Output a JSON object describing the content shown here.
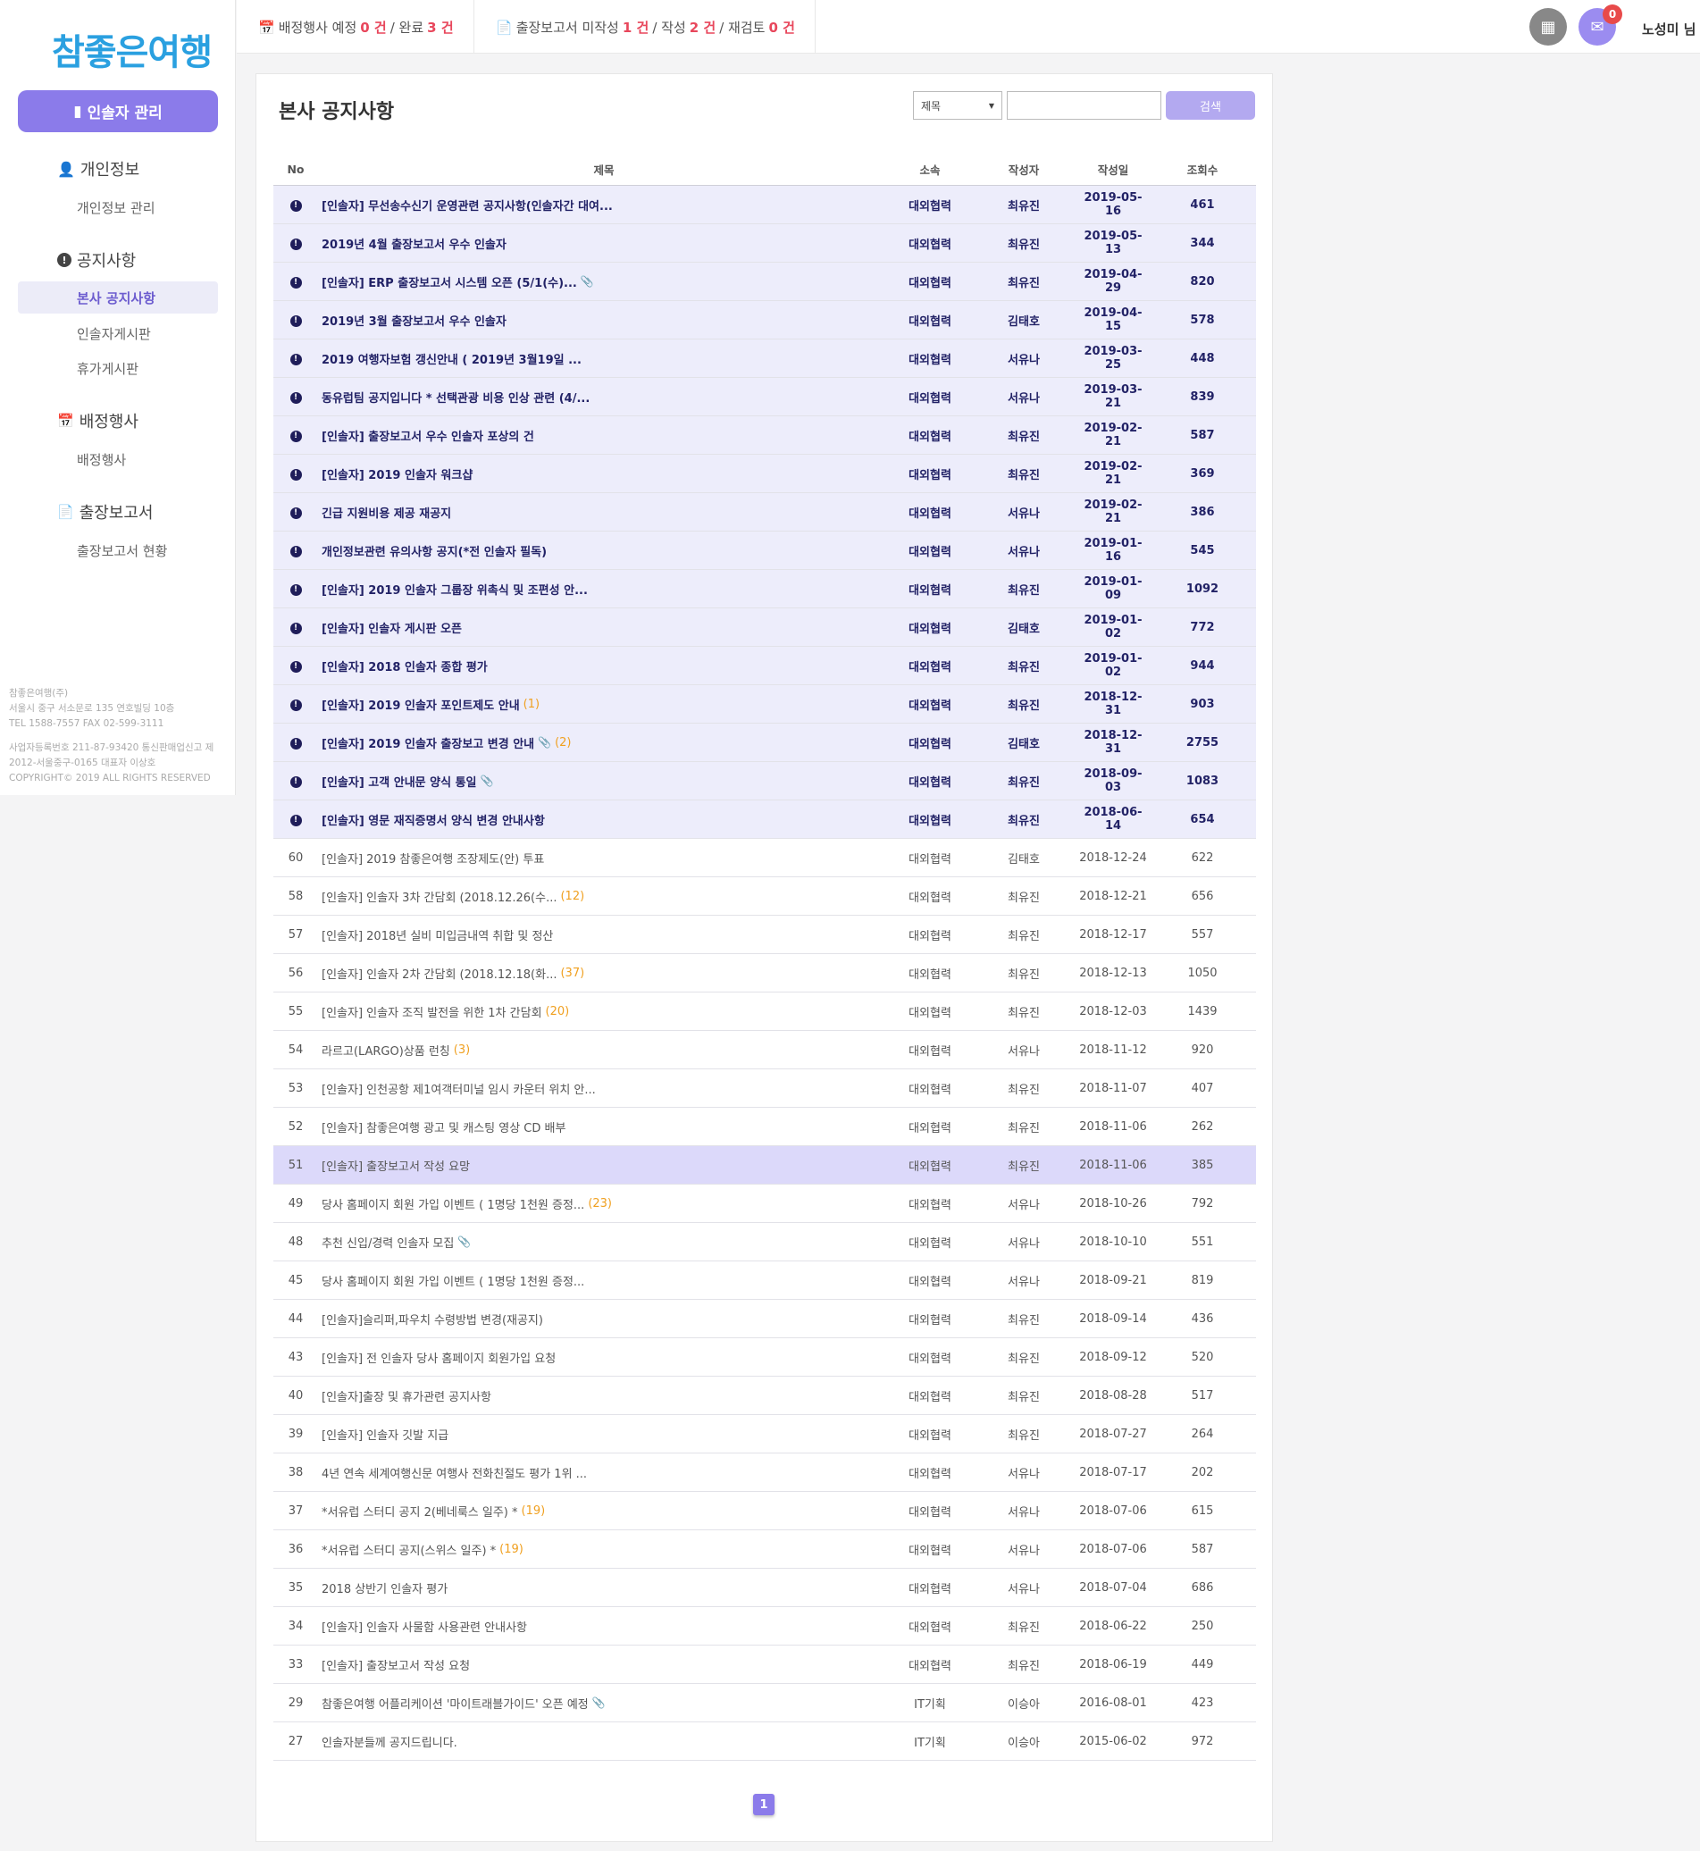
{
  "logo": "참좋은여행",
  "sidebar": {
    "manager_button": "인솔자 관리",
    "sections": [
      {
        "title": "개인정보",
        "icon": "user-edit-icon",
        "items": [
          "개인정보 관리"
        ]
      },
      {
        "title": "공지사항",
        "icon": "info-circle-icon",
        "items": [
          "본사 공지사항",
          "인솔자게시판",
          "휴가게시판"
        ],
        "active": "본사 공지사항"
      },
      {
        "title": "배정행사",
        "icon": "calendar-icon",
        "items": [
          "배정행사"
        ]
      },
      {
        "title": "출장보고서",
        "icon": "file-icon",
        "items": [
          "출장보고서 현황"
        ]
      }
    ],
    "footer": [
      "참좋은여행(주)",
      "서울시 중구 서소문로 135 연호빌딩 10층",
      "TEL 1588-7557 FAX 02-599-3111",
      "",
      "사업자등록번호 211-87-93420 통신판매업신고 제",
      "2012-서울중구-0165 대표자 이상호",
      "COPYRIGHT© 2019 ALL RIGHTS RESERVED"
    ]
  },
  "topbar": {
    "event_label": "배정행사 예정",
    "event_planned": "0 건",
    "event_sep": "/ 완료",
    "event_done": "3 건",
    "report_label": "출장보고서 미작성",
    "report_unwritten": "1 건",
    "report_sep1": "/ 작성",
    "report_written": "2 건",
    "report_sep2": "/ 재검토",
    "report_review": "0 건",
    "mail_badge": "0",
    "user": "노성미 님"
  },
  "board": {
    "title": "본사 공지사항",
    "search_option": "제목",
    "search_placeholder": "",
    "search_button": "검색",
    "headers": {
      "no": "No",
      "title": "제목",
      "dept": "소속",
      "author": "작성자",
      "date": "작성일",
      "views": "조회수"
    },
    "notices": [
      {
        "title": "[인솔자] 무선송수신기 운영관련 공지사항(인솔자간 대여...",
        "dept": "대외협력",
        "author": "최유진",
        "date": "2019-05-16",
        "views": "461"
      },
      {
        "title": "2019년 4월 출장보고서 우수 인솔자",
        "dept": "대외협력",
        "author": "최유진",
        "date": "2019-05-13",
        "views": "344"
      },
      {
        "title": "[인솔자] ERP 출장보고서 시스템 오픈 (5/1(수)...",
        "clip": true,
        "dept": "대외협력",
        "author": "최유진",
        "date": "2019-04-29",
        "views": "820"
      },
      {
        "title": "2019년 3월 출장보고서 우수 인솔자",
        "dept": "대외협력",
        "author": "김태호",
        "date": "2019-04-15",
        "views": "578"
      },
      {
        "title": "2019 여행자보험 갱신안내 ( 2019년 3월19일 ...",
        "dept": "대외협력",
        "author": "서유나",
        "date": "2019-03-25",
        "views": "448"
      },
      {
        "title": "동유럽팀 공지입니다 * 선택관광 비용 인상 관련 (4/...",
        "dept": "대외협력",
        "author": "서유나",
        "date": "2019-03-21",
        "views": "839"
      },
      {
        "title": "[인솔자] 출장보고서 우수 인솔자 포상의 건",
        "dept": "대외협력",
        "author": "최유진",
        "date": "2019-02-21",
        "views": "587"
      },
      {
        "title": "[인솔자] 2019 인솔자 워크샵",
        "dept": "대외협력",
        "author": "최유진",
        "date": "2019-02-21",
        "views": "369"
      },
      {
        "title": "긴급 지원비용 제공 재공지",
        "dept": "대외협력",
        "author": "서유나",
        "date": "2019-02-21",
        "views": "386"
      },
      {
        "title": "개인정보관련 유의사항 공지(*전 인솔자 필독)",
        "dept": "대외협력",
        "author": "서유나",
        "date": "2019-01-16",
        "views": "545"
      },
      {
        "title": "[인솔자] 2019 인솔자 그룹장 위촉식 및 조편성 안...",
        "dept": "대외협력",
        "author": "최유진",
        "date": "2019-01-09",
        "views": "1092"
      },
      {
        "title": "[인솔자] 인솔자 게시판 오픈",
        "dept": "대외협력",
        "author": "김태호",
        "date": "2019-01-02",
        "views": "772"
      },
      {
        "title": "[인솔자] 2018 인솔자 종합 평가",
        "dept": "대외협력",
        "author": "최유진",
        "date": "2019-01-02",
        "views": "944"
      },
      {
        "title": "[인솔자] 2019 인솔자 포인트제도 안내",
        "comments": "(1)",
        "dept": "대외협력",
        "author": "최유진",
        "date": "2018-12-31",
        "views": "903"
      },
      {
        "title": "[인솔자] 2019 인솔자 출장보고 변경 안내",
        "clip": true,
        "comments": "(2)",
        "dept": "대외협력",
        "author": "김태호",
        "date": "2018-12-31",
        "views": "2755"
      },
      {
        "title": "[인솔자] 고객 안내문 양식 통일",
        "clip": true,
        "dept": "대외협력",
        "author": "최유진",
        "date": "2018-09-03",
        "views": "1083"
      },
      {
        "title": "[인솔자] 영문 재직증명서 양식 변경 안내사항",
        "dept": "대외협력",
        "author": "최유진",
        "date": "2018-06-14",
        "views": "654"
      }
    ],
    "posts": [
      {
        "no": "60",
        "title": "[인솔자] 2019 참좋은여행 조장제도(안) 투표",
        "dept": "대외협력",
        "author": "김태호",
        "date": "2018-12-24",
        "views": "622"
      },
      {
        "no": "58",
        "title": "[인솔자] 인솔자 3차 간담회 (2018.12.26(수...",
        "comments": "(12)",
        "dept": "대외협력",
        "author": "최유진",
        "date": "2018-12-21",
        "views": "656"
      },
      {
        "no": "57",
        "title": "[인솔자] 2018년 실비 미입금내역 취합 및 정산",
        "dept": "대외협력",
        "author": "최유진",
        "date": "2018-12-17",
        "views": "557"
      },
      {
        "no": "56",
        "title": "[인솔자] 인솔자 2차 간담회 (2018.12.18(화...",
        "comments": "(37)",
        "dept": "대외협력",
        "author": "최유진",
        "date": "2018-12-13",
        "views": "1050"
      },
      {
        "no": "55",
        "title": "[인솔자] 인솔자 조직 발전을 위한 1차 간담회",
        "comments": "(20)",
        "dept": "대외협력",
        "author": "최유진",
        "date": "2018-12-03",
        "views": "1439"
      },
      {
        "no": "54",
        "title": "라르고(LARGO)상품 런칭",
        "comments": "(3)",
        "dept": "대외협력",
        "author": "서유나",
        "date": "2018-11-12",
        "views": "920"
      },
      {
        "no": "53",
        "title": "[인솔자] 인천공항 제1여객터미널 임시 카운터 위치 안...",
        "dept": "대외협력",
        "author": "최유진",
        "date": "2018-11-07",
        "views": "407"
      },
      {
        "no": "52",
        "title": "[인솔자] 참좋은여행 광고 및 캐스팅 영상 CD 배부",
        "dept": "대외협력",
        "author": "최유진",
        "date": "2018-11-06",
        "views": "262"
      },
      {
        "no": "51",
        "title": "[인솔자] 출장보고서 작성 요망",
        "dept": "대외협력",
        "author": "최유진",
        "date": "2018-11-06",
        "views": "385",
        "hilite": true
      },
      {
        "no": "49",
        "title": "당사 홈페이지 회원 가입 이벤트 ( 1명당 1천원 증정...",
        "comments": "(23)",
        "dept": "대외협력",
        "author": "서유나",
        "date": "2018-10-26",
        "views": "792"
      },
      {
        "no": "48",
        "title": "추천 신입/경력 인솔자 모집",
        "clip": true,
        "dept": "대외협력",
        "author": "서유나",
        "date": "2018-10-10",
        "views": "551"
      },
      {
        "no": "45",
        "title": "당사 홈페이지 회원 가입 이벤트 ( 1명당 1천원 증정...",
        "dept": "대외협력",
        "author": "서유나",
        "date": "2018-09-21",
        "views": "819"
      },
      {
        "no": "44",
        "title": "[인솔자]슬리퍼,파우치 수령방법 변경(재공지)",
        "dept": "대외협력",
        "author": "최유진",
        "date": "2018-09-14",
        "views": "436"
      },
      {
        "no": "43",
        "title": "[인솔자] 전 인솔자 당사 홈페이지 회원가입 요청",
        "dept": "대외협력",
        "author": "최유진",
        "date": "2018-09-12",
        "views": "520"
      },
      {
        "no": "40",
        "title": "[인솔자]출장 및 휴가관련 공지사항",
        "dept": "대외협력",
        "author": "최유진",
        "date": "2018-08-28",
        "views": "517"
      },
      {
        "no": "39",
        "title": "[인솔자] 인솔자 깃발 지급",
        "dept": "대외협력",
        "author": "최유진",
        "date": "2018-07-27",
        "views": "264"
      },
      {
        "no": "38",
        "title": "4년 연속 세계여행신문 여행사 전화친절도 평가 1위 ...",
        "dept": "대외협력",
        "author": "서유나",
        "date": "2018-07-17",
        "views": "202"
      },
      {
        "no": "37",
        "title": "*서유럽 스터디 공지 2(베네룩스 일주) *",
        "comments": "(19)",
        "dept": "대외협력",
        "author": "서유나",
        "date": "2018-07-06",
        "views": "615"
      },
      {
        "no": "36",
        "title": "*서유럽 스터디 공지(스위스 일주) *",
        "comments": "(19)",
        "dept": "대외협력",
        "author": "서유나",
        "date": "2018-07-06",
        "views": "587"
      },
      {
        "no": "35",
        "title": "2018 상반기 인솔자 평가",
        "dept": "대외협력",
        "author": "서유나",
        "date": "2018-07-04",
        "views": "686"
      },
      {
        "no": "34",
        "title": "[인솔자] 인솔자 사물함 사용관련 안내사항",
        "dept": "대외협력",
        "author": "최유진",
        "date": "2018-06-22",
        "views": "250"
      },
      {
        "no": "33",
        "title": "[인솔자] 출장보고서 작성 요청",
        "dept": "대외협력",
        "author": "최유진",
        "date": "2018-06-19",
        "views": "449"
      },
      {
        "no": "29",
        "title": "참좋은여행 어플리케이션 '마이트래블가이드' 오픈 예정",
        "clip": true,
        "dept": "IT기획",
        "author": "이승아",
        "date": "2016-08-01",
        "views": "423"
      },
      {
        "no": "27",
        "title": "인솔자분들께 공지드립니다.",
        "dept": "IT기획",
        "author": "이승아",
        "date": "2015-06-02",
        "views": "972"
      }
    ],
    "page": "1"
  }
}
